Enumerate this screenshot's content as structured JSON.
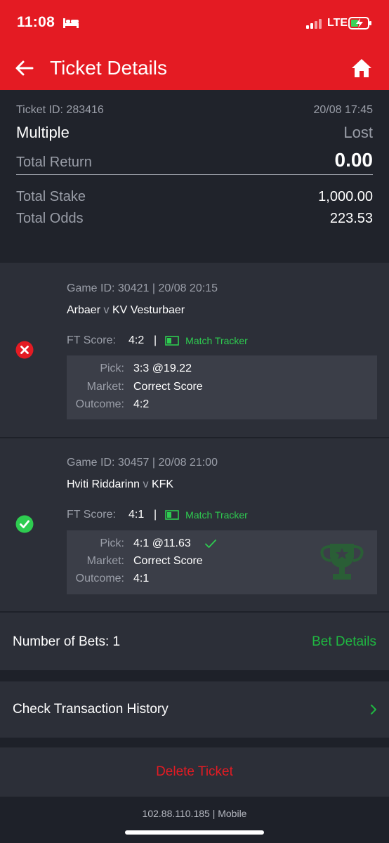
{
  "status_bar": {
    "time": "11:08",
    "network": "LTE"
  },
  "header": {
    "title": "Ticket Details"
  },
  "ticket": {
    "id_label": "Ticket ID: 283416",
    "date": "20/08 17:45",
    "type": "Multiple",
    "result": "Lost",
    "total_return_label": "Total Return",
    "total_return_value": "0.00",
    "total_stake_label": "Total Stake",
    "total_stake_value": "1,000.00",
    "total_odds_label": "Total Odds",
    "total_odds_value": "223.53"
  },
  "games": [
    {
      "meta": "Game ID: 30421 | 20/08 20:15",
      "home": "Arbaer",
      "sep": "v",
      "away": "KV Vesturbaer",
      "ft_label": "FT Score:",
      "ft_score": "4:2",
      "tracker": "Match Tracker",
      "pick_label": "Pick:",
      "pick_value": "3:3 @19.22",
      "market_label": "Market:",
      "market_value": "Correct Score",
      "outcome_label": "Outcome:",
      "outcome_value": "4:2",
      "status": "lost"
    },
    {
      "meta": "Game ID: 30457 | 20/08 21:00",
      "home": "Hviti Riddarinn",
      "sep": "v",
      "away": "KFK",
      "ft_label": "FT Score:",
      "ft_score": "4:1",
      "tracker": "Match Tracker",
      "pick_label": "Pick:",
      "pick_value": "4:1 @11.63",
      "market_label": "Market:",
      "market_value": "Correct Score",
      "outcome_label": "Outcome:",
      "outcome_value": "4:1",
      "status": "won"
    }
  ],
  "bets": {
    "label": "Number of Bets: 1",
    "link": "Bet Details"
  },
  "history": {
    "label": "Check Transaction History"
  },
  "delete": {
    "label": "Delete Ticket"
  },
  "footer": {
    "text": "102.88.110.185 | Mobile"
  },
  "colors": {
    "brand_red": "#e41b23",
    "win_green": "#2ecc50",
    "link_green": "#1fb841",
    "bg": "#1e2129",
    "card": "#2c2f38"
  },
  "icons": [
    "back-arrow-icon",
    "home-icon",
    "lost-x-icon",
    "won-check-icon",
    "match-tracker-icon",
    "check-mark-icon",
    "trophy-icon",
    "chevron-right-icon"
  ]
}
